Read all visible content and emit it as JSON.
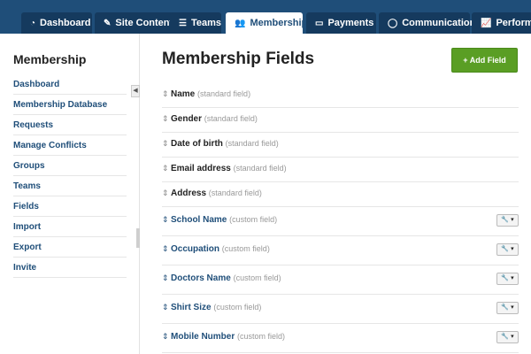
{
  "nav": {
    "tabs": [
      {
        "icon": "dashboard-icon",
        "glyph": "◔",
        "label": "Dashboard"
      },
      {
        "icon": "pencil-icon",
        "glyph": "✎",
        "label": "Site Content"
      },
      {
        "icon": "list-icon",
        "glyph": "☰",
        "label": "Teams"
      },
      {
        "icon": "users-icon",
        "glyph": "👥",
        "label": "Membership",
        "active": true
      },
      {
        "icon": "credit-card-icon",
        "glyph": "▭",
        "label": "Payments"
      },
      {
        "icon": "chat-bubble-icon",
        "glyph": "◯",
        "label": "Communication"
      },
      {
        "icon": "chart-icon",
        "glyph": "📈",
        "label": "Performance"
      }
    ]
  },
  "sidebar": {
    "title": "Membership",
    "collapse_glyph": "◀",
    "items": [
      {
        "label": "Dashboard"
      },
      {
        "label": "Membership Database"
      },
      {
        "label": "Requests"
      },
      {
        "label": "Manage Conflicts"
      },
      {
        "label": "Groups"
      },
      {
        "label": "Teams"
      },
      {
        "label": "Fields"
      },
      {
        "label": "Import"
      },
      {
        "label": "Export"
      },
      {
        "label": "Invite"
      }
    ]
  },
  "main": {
    "title": "Membership Fields",
    "add_button": "+ Add Field",
    "fields": [
      {
        "name": "Name",
        "type": "(standard field)"
      },
      {
        "name": "Gender",
        "type": "(standard field)"
      },
      {
        "name": "Date of birth",
        "type": "(standard field)"
      },
      {
        "name": "Email address",
        "type": "(standard field)"
      },
      {
        "name": "Address",
        "type": "(standard field)"
      },
      {
        "name": "School Name",
        "type": "(custom field)"
      },
      {
        "name": "Occupation",
        "type": "(custom field)"
      },
      {
        "name": "Doctors Name",
        "type": "(custom field)"
      },
      {
        "name": "Shirt Size",
        "type": "(custom field)"
      },
      {
        "name": "Mobile Number",
        "type": "(custom field)"
      }
    ],
    "handle_glyph": "⇕",
    "tool_glyph": "🔧 ▾"
  }
}
